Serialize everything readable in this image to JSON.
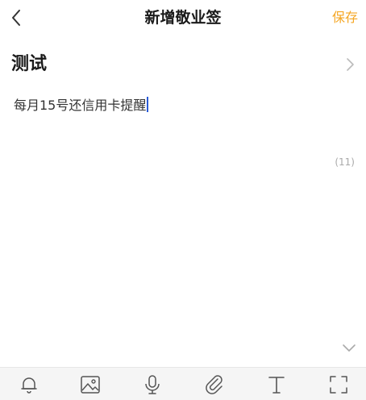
{
  "nav": {
    "title": "新增敬业签",
    "save_label": "保存"
  },
  "category": {
    "label": "测试"
  },
  "note": {
    "content": "每月15号还信用卡提醒"
  },
  "char_count": "(11)",
  "toolbar": {
    "items": [
      "bell-icon",
      "image-icon",
      "microphone-icon",
      "paperclip-icon",
      "text-format-icon",
      "fullscreen-icon"
    ]
  },
  "colors": {
    "accent": "#f5a623",
    "caret": "#2a5bd7",
    "toolbar_bg": "#f5f5f5"
  }
}
